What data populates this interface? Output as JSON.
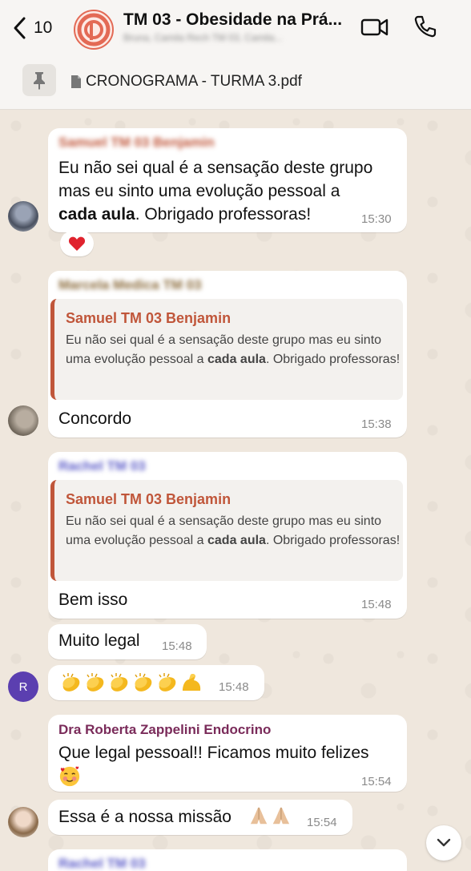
{
  "header": {
    "back_count": "10",
    "title": "TM 03 - Obesidade na Prá...",
    "subtitle": "Bruna, Camila Rech TM 03, Camila...",
    "icons": [
      "back-chevron-icon",
      "group-logo-icon",
      "video-call-icon",
      "phone-call-icon"
    ]
  },
  "pinned": {
    "file_name": "CRONOGRAMA - TURMA 3.pdf",
    "icons": [
      "pin-icon",
      "document-icon"
    ]
  },
  "messages": [
    {
      "sender": "Samuel TM 03 Benjamin",
      "text_part1": "Eu não sei qual é a sensação deste grupo",
      "text_part2": "mas eu sinto uma evolução pessoal a",
      "text_bold": "cada aula",
      "text_part3": ". Obrigado professoras!",
      "time": "15:30",
      "reaction": "heart"
    },
    {
      "sender": "Marcela Medica TM 03",
      "quote": {
        "sender": "Samuel TM 03 Benjamin",
        "text_part1": "Eu não sei qual é a sensação deste grupo mas eu sinto uma evolução pessoal a ",
        "text_bold": "cada aula",
        "text_part2": ". Obrigado professoras!"
      },
      "text": "Concordo",
      "time": "15:38"
    },
    {
      "sender": "Rachel TM 03",
      "quote": {
        "sender": "Samuel TM 03 Benjamin",
        "text_part1": "Eu não sei qual é a sensação deste grupo mas eu sinto uma evolução pessoal a ",
        "text_bold": "cada aula",
        "text_part2": ". Obrigado professoras!"
      },
      "text": "Bem isso",
      "time": "15:48"
    },
    {
      "text": "Muito legal",
      "time": "15:48"
    },
    {
      "emojis": "clapping hands x5, flexed biceps",
      "time": "15:48",
      "avatar_initial": "R"
    },
    {
      "sender": "Dra Roberta Zappelini Endocrino",
      "text": "Que legal pessoal!! Ficamos muito felizes",
      "emoji": "smiling face with hearts",
      "time": "15:54"
    },
    {
      "text": "Essa é a nossa missão",
      "emoji": "folded hands x2",
      "time": "15:54"
    },
    {
      "sender": "Rachel TM 03"
    }
  ],
  "colors": {
    "accent_quote": "#c0563a",
    "sender_samuel": "#c0563a",
    "sender_marcela": "#8a6a3a",
    "sender_rachel": "#5b5bc8",
    "sender_roberta": "#7a2b5a",
    "avatar_r": "#5b3fb0"
  }
}
